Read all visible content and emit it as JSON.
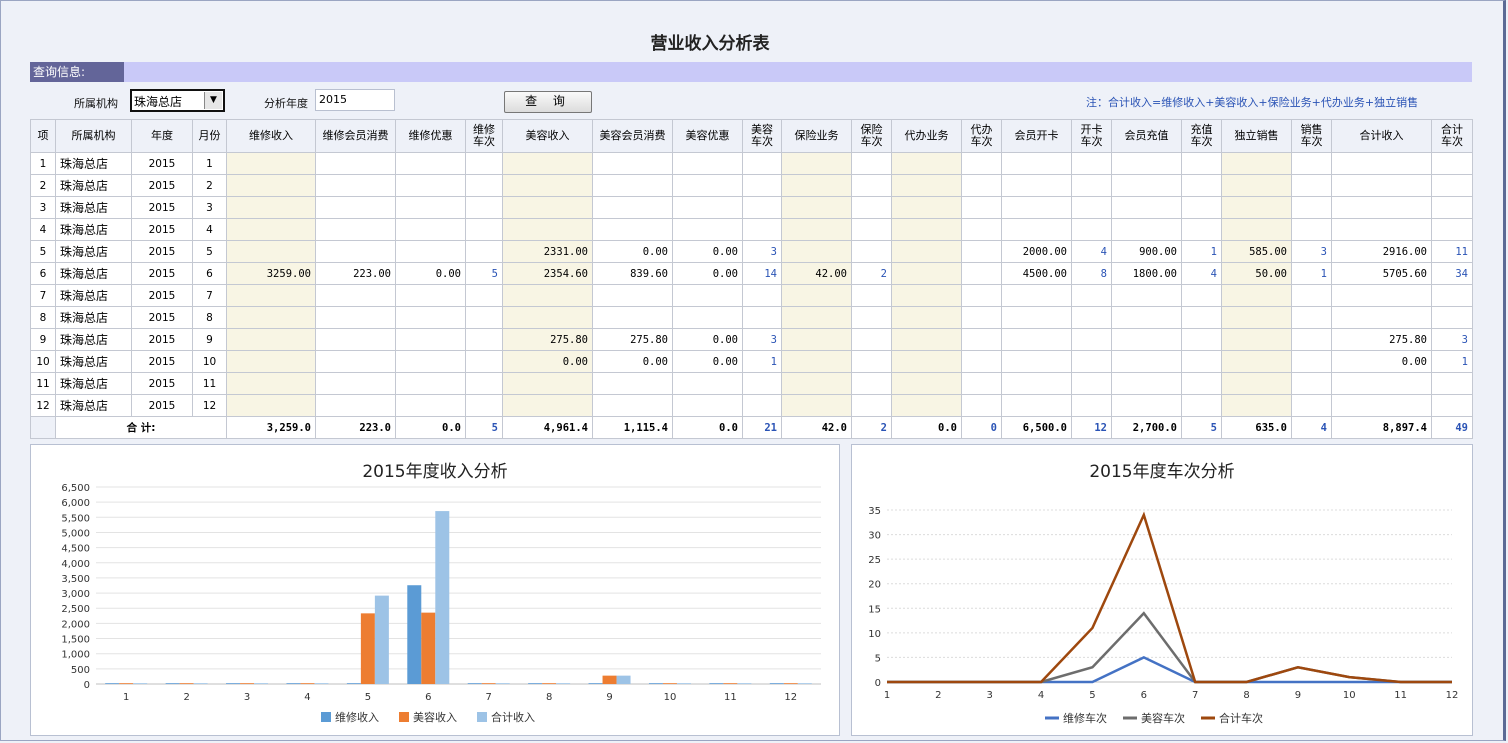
{
  "title": "营业收入分析表",
  "query": {
    "section_label": "查询信息:",
    "org_label": "所属机构",
    "org_value": "珠海总店",
    "year_label": "分析年度",
    "year_value": "2015",
    "button_label": "查  询",
    "note": "注：合计收入=维修收入+美容收入+保险业务+代办业务+独立销售"
  },
  "table": {
    "headers": [
      "项",
      "所属机构",
      "年度",
      "月份",
      "维修收入",
      "维修会员消费",
      "维修优惠",
      "维修\n车次",
      "美容收入",
      "美容会员消费",
      "美容优惠",
      "美容\n车次",
      "保险业务",
      "保险\n车次",
      "代办业务",
      "代办\n车次",
      "会员开卡",
      "开卡\n车次",
      "会员充值",
      "充值\n车次",
      "独立销售",
      "销售\n车次",
      "合计收入",
      "合计\n车次"
    ],
    "rows": [
      [
        "1",
        "珠海总店",
        "2015",
        "1",
        "",
        "",
        "",
        "",
        "",
        "",
        "",
        "",
        "",
        "",
        "",
        "",
        "",
        "",
        "",
        "",
        "",
        "",
        "",
        ""
      ],
      [
        "2",
        "珠海总店",
        "2015",
        "2",
        "",
        "",
        "",
        "",
        "",
        "",
        "",
        "",
        "",
        "",
        "",
        "",
        "",
        "",
        "",
        "",
        "",
        "",
        "",
        ""
      ],
      [
        "3",
        "珠海总店",
        "2015",
        "3",
        "",
        "",
        "",
        "",
        "",
        "",
        "",
        "",
        "",
        "",
        "",
        "",
        "",
        "",
        "",
        "",
        "",
        "",
        "",
        ""
      ],
      [
        "4",
        "珠海总店",
        "2015",
        "4",
        "",
        "",
        "",
        "",
        "",
        "",
        "",
        "",
        "",
        "",
        "",
        "",
        "",
        "",
        "",
        "",
        "",
        "",
        "",
        ""
      ],
      [
        "5",
        "珠海总店",
        "2015",
        "5",
        "",
        "",
        "",
        "",
        "2331.00",
        "0.00",
        "0.00",
        "3",
        "",
        "",
        "",
        "",
        "2000.00",
        "4",
        "900.00",
        "1",
        "585.00",
        "3",
        "2916.00",
        "11"
      ],
      [
        "6",
        "珠海总店",
        "2015",
        "6",
        "3259.00",
        "223.00",
        "0.00",
        "5",
        "2354.60",
        "839.60",
        "0.00",
        "14",
        "42.00",
        "2",
        "",
        "",
        "4500.00",
        "8",
        "1800.00",
        "4",
        "50.00",
        "1",
        "5705.60",
        "34"
      ],
      [
        "7",
        "珠海总店",
        "2015",
        "7",
        "",
        "",
        "",
        "",
        "",
        "",
        "",
        "",
        "",
        "",
        "",
        "",
        "",
        "",
        "",
        "",
        "",
        "",
        "",
        ""
      ],
      [
        "8",
        "珠海总店",
        "2015",
        "8",
        "",
        "",
        "",
        "",
        "",
        "",
        "",
        "",
        "",
        "",
        "",
        "",
        "",
        "",
        "",
        "",
        "",
        "",
        "",
        ""
      ],
      [
        "9",
        "珠海总店",
        "2015",
        "9",
        "",
        "",
        "",
        "",
        "275.80",
        "275.80",
        "0.00",
        "3",
        "",
        "",
        "",
        "",
        "",
        "",
        "",
        "",
        "",
        "",
        "275.80",
        "3"
      ],
      [
        "10",
        "珠海总店",
        "2015",
        "10",
        "",
        "",
        "",
        "",
        "0.00",
        "0.00",
        "0.00",
        "1",
        "",
        "",
        "",
        "",
        "",
        "",
        "",
        "",
        "",
        "",
        "0.00",
        "1"
      ],
      [
        "11",
        "珠海总店",
        "2015",
        "11",
        "",
        "",
        "",
        "",
        "",
        "",
        "",
        "",
        "",
        "",
        "",
        "",
        "",
        "",
        "",
        "",
        "",
        "",
        "",
        ""
      ],
      [
        "12",
        "珠海总店",
        "2015",
        "12",
        "",
        "",
        "",
        "",
        "",
        "",
        "",
        "",
        "",
        "",
        "",
        "",
        "",
        "",
        "",
        "",
        "",
        "",
        "",
        ""
      ]
    ],
    "total_label": "合  计:",
    "totals": [
      "3,259.0",
      "223.0",
      "0.0",
      "5",
      "4,961.4",
      "1,115.4",
      "0.0",
      "21",
      "42.0",
      "2",
      "0.0",
      "0",
      "6,500.0",
      "12",
      "2,700.0",
      "5",
      "635.0",
      "4",
      "8,897.4",
      "49"
    ]
  },
  "chart_data": [
    {
      "type": "bar",
      "title": "2015年度收入分析",
      "categories": [
        "1",
        "2",
        "3",
        "4",
        "5",
        "6",
        "7",
        "8",
        "9",
        "10",
        "11",
        "12"
      ],
      "series": [
        {
          "name": "维修收入",
          "color": "#5b9bd5",
          "values": [
            0,
            0,
            0,
            0,
            0,
            3259,
            0,
            0,
            0,
            0,
            0,
            0
          ]
        },
        {
          "name": "美容收入",
          "color": "#ed7d31",
          "values": [
            0,
            0,
            0,
            0,
            2331,
            2354.6,
            0,
            0,
            275.8,
            0,
            0,
            0
          ]
        },
        {
          "name": "合计收入",
          "color": "#9dc3e6",
          "values": [
            0,
            0,
            0,
            0,
            2916,
            5705.6,
            0,
            0,
            275.8,
            0,
            0,
            0
          ]
        }
      ],
      "ylim": [
        0,
        6500
      ],
      "yticks": [
        "0",
        "500",
        "1,000",
        "1,500",
        "2,000",
        "2,500",
        "3,000",
        "3,500",
        "4,000",
        "4,500",
        "5,000",
        "5,500",
        "6,000",
        "6,500"
      ],
      "grid": true,
      "legend": "bottom"
    },
    {
      "type": "line",
      "title": "2015年度车次分析",
      "categories": [
        "1",
        "2",
        "3",
        "4",
        "5",
        "6",
        "7",
        "8",
        "9",
        "10",
        "11",
        "12"
      ],
      "series": [
        {
          "name": "维修车次",
          "color": "#4472c4",
          "values": [
            0,
            0,
            0,
            0,
            0,
            5,
            0,
            0,
            0,
            0,
            0,
            0
          ]
        },
        {
          "name": "美容车次",
          "color": "#6d6d6d",
          "values": [
            0,
            0,
            0,
            0,
            3,
            14,
            0,
            0,
            3,
            1,
            0,
            0
          ]
        },
        {
          "name": "合计车次",
          "color": "#9e480e",
          "values": [
            0,
            0,
            0,
            0,
            11,
            34,
            0,
            0,
            3,
            1,
            0,
            0
          ]
        }
      ],
      "ylim": [
        0,
        35
      ],
      "yticks": [
        "0",
        "5",
        "10",
        "15",
        "20",
        "25",
        "30",
        "35"
      ],
      "grid": true,
      "legend": "bottom"
    }
  ]
}
